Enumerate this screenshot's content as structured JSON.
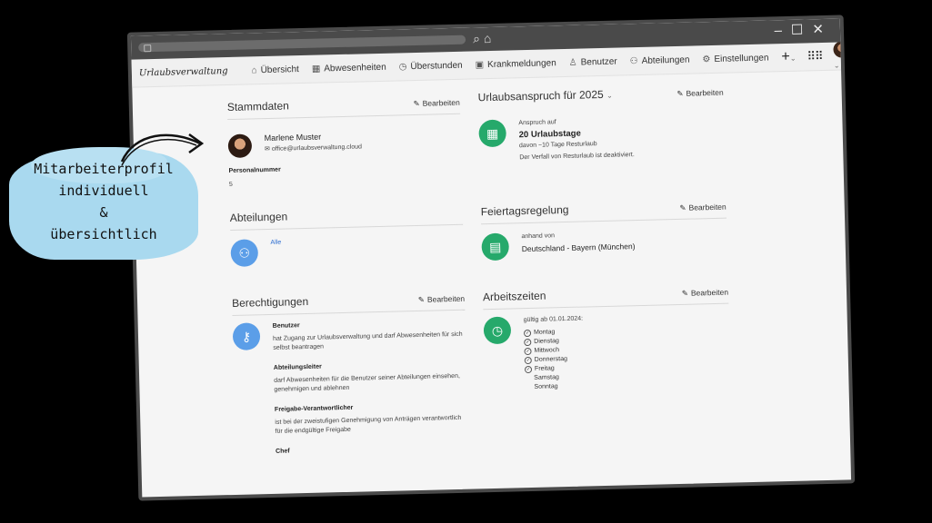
{
  "caption": {
    "lines": [
      "Mitarbeiterprofil",
      "individuell",
      "&",
      "übersichtlich"
    ]
  },
  "nav": {
    "brand": "Urlaubsverwaltung",
    "items": [
      {
        "label": "Übersicht",
        "icon": "home-icon"
      },
      {
        "label": "Abwesenheiten",
        "icon": "calendar-icon"
      },
      {
        "label": "Überstunden",
        "icon": "clock-icon"
      },
      {
        "label": "Krankmeldungen",
        "icon": "medical-bag-icon"
      },
      {
        "label": "Benutzer",
        "icon": "user-icon"
      },
      {
        "label": "Abteilungen",
        "icon": "users-icon"
      },
      {
        "label": "Einstellungen",
        "icon": "gear-icon"
      }
    ]
  },
  "edit_label": "Bearbeiten",
  "stammdaten": {
    "title": "Stammdaten",
    "name": "Marlene Muster",
    "email": "office@urlaubsverwaltung.cloud",
    "personalnummer_label": "Personalnummer",
    "personalnummer": "5"
  },
  "urlaub": {
    "title": "Urlaubsanspruch für 2025",
    "anspruch_label": "Anspruch auf",
    "tage": "20 Urlaubstage",
    "davon": "davon ~10 Tage Resturlaub",
    "verfall": "Der Verfall von Resturlaub ist deaktiviert."
  },
  "abteilungen": {
    "title": "Abteilungen",
    "value": "Alle"
  },
  "feiertag": {
    "title": "Feiertagsregelung",
    "anhand_label": "anhand von",
    "value": "Deutschland - Bayern (München)"
  },
  "berechtigungen": {
    "title": "Berechtigungen",
    "roles": [
      {
        "name": "Benutzer",
        "desc": "hat Zugang zur Urlaubsverwaltung und darf Abwesenheiten für sich selbst beantragen"
      },
      {
        "name": "Abteilungsleiter",
        "desc": "darf Abwesenheiten für die Benutzer seiner Abteilungen einsehen, genehmigen und ablehnen"
      },
      {
        "name": "Freigabe-Verantwortlicher",
        "desc": "ist bei der zweistufigen Genehmigung von Anträgen verantwortlich für die endgültige Freigabe"
      },
      {
        "name": "Chef",
        "desc": ""
      }
    ]
  },
  "arbeitszeiten": {
    "title": "Arbeitszeiten",
    "gueltig": "gültig ab 01.01.2024:",
    "days": [
      {
        "label": "Montag",
        "checked": true
      },
      {
        "label": "Dienstag",
        "checked": true
      },
      {
        "label": "Mittwoch",
        "checked": true
      },
      {
        "label": "Donnerstag",
        "checked": true
      },
      {
        "label": "Freitag",
        "checked": true
      },
      {
        "label": "Samstag",
        "checked": false
      },
      {
        "label": "Sonntag",
        "checked": false
      }
    ]
  }
}
